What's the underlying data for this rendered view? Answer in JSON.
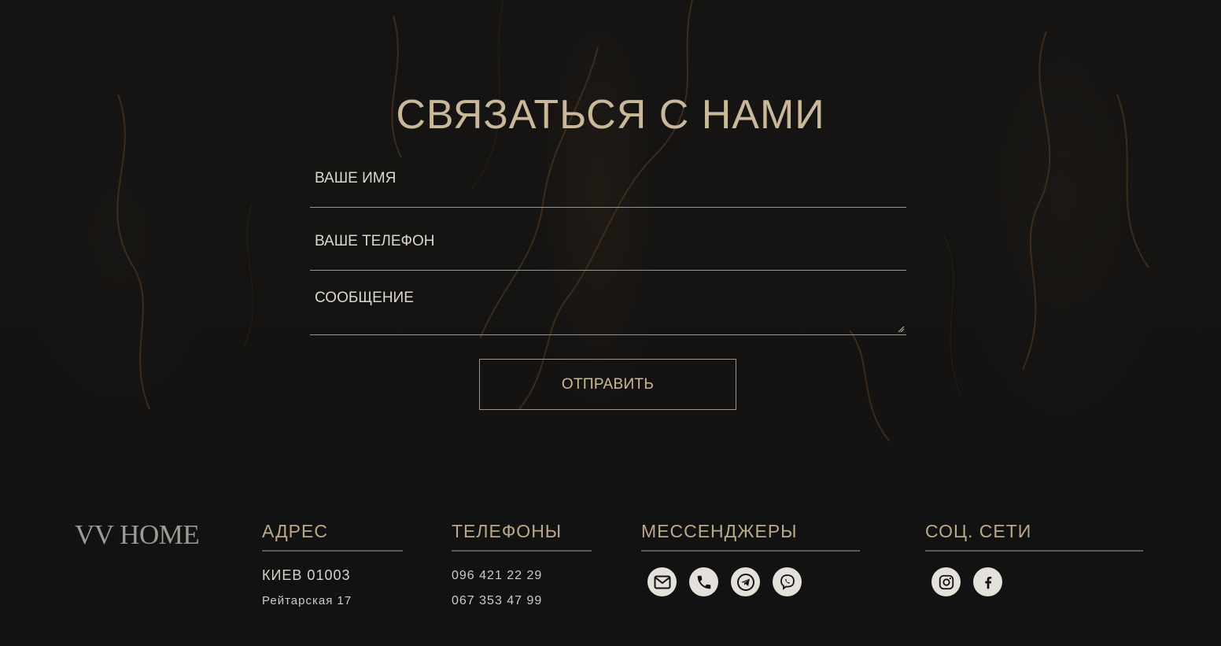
{
  "contact": {
    "title": "СВЯЗАТЬСЯ С НАМИ",
    "name_placeholder": "ВАШЕ ИМЯ",
    "phone_placeholder": "ВАШЕ ТЕЛЕФОН",
    "message_placeholder": "СООБЩЕНИЕ",
    "submit_label": "ОТПРАВИТЬ"
  },
  "footer": {
    "logo": "VV HOME",
    "address": {
      "heading": "АДРЕС",
      "city": "КИЕВ 01003",
      "street": "Рейтарская 17"
    },
    "phones": {
      "heading": "ТЕЛЕФОНЫ",
      "numbers": [
        "096 421 22 29",
        "067 353 47 99"
      ]
    },
    "messengers": {
      "heading": "МЕССЕНДЖЕРЫ",
      "icons": [
        "email-icon",
        "phone-icon",
        "telegram-icon",
        "viber-icon"
      ]
    },
    "social": {
      "heading": "СОЦ. СЕТИ",
      "icons": [
        "instagram-icon",
        "facebook-icon"
      ]
    }
  },
  "colors": {
    "accent": "#c9b89a",
    "background": "#121212",
    "line": "#9c9488"
  }
}
